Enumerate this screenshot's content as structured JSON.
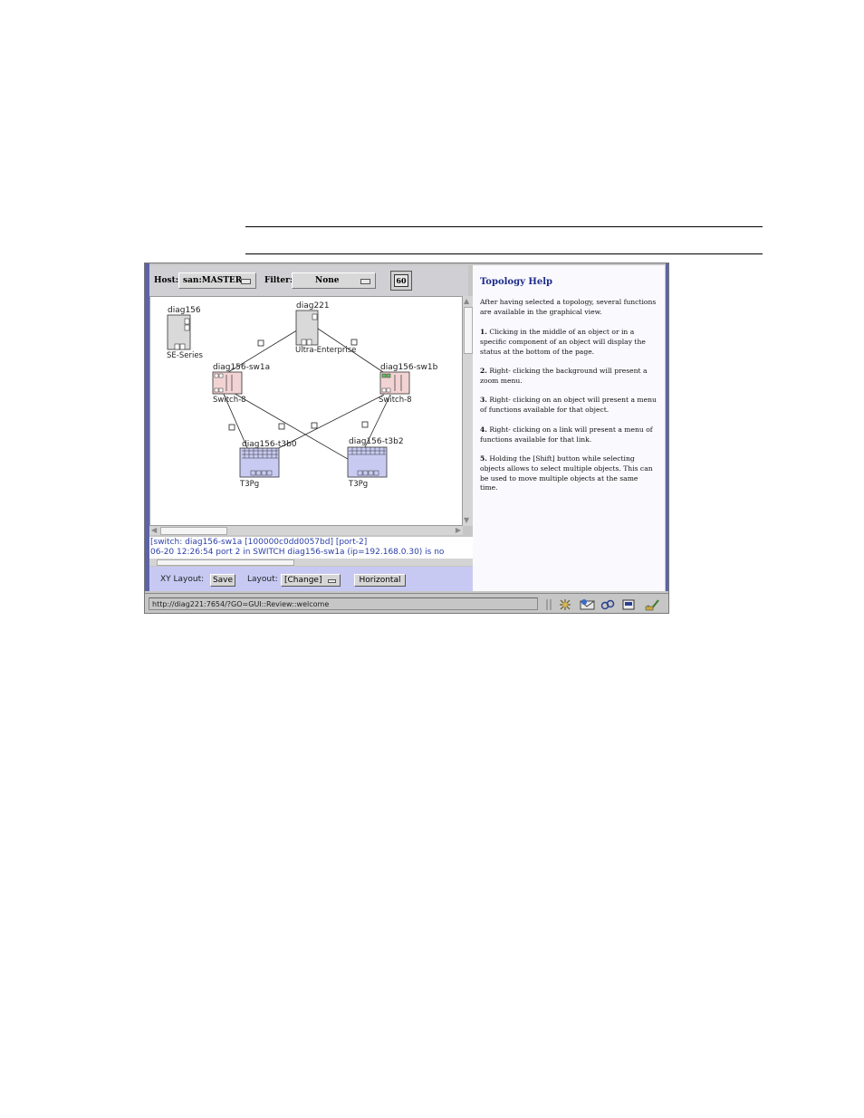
{
  "toolbar": {
    "host_label": "Host:",
    "host_value": "san:MASTER",
    "filter_label": "Filter:",
    "filter_value": "None",
    "go_label": "60"
  },
  "topology": {
    "nodes": {
      "diag156": {
        "name": "diag156",
        "type": "SE-Series"
      },
      "diag221": {
        "name": "diag221",
        "type": "Ultra-Enterprise"
      },
      "sw1a": {
        "name": "diag156-sw1a",
        "type": "Switch-8"
      },
      "sw1b": {
        "name": "diag156-sw1b",
        "type": "Switch-8"
      },
      "t3b0": {
        "name": "diag156-t3b0",
        "type": "T3Pg"
      },
      "t3b2": {
        "name": "diag156-t3b2",
        "type": "T3Pg"
      }
    }
  },
  "status": {
    "line1": "[switch: diag156-sw1a [100000c0dd0057bd]  [port-2]",
    "line2": " 06-20 12:26:54  port 2  in SWITCH diag156-sw1a (ip=192.168.0.30) is no"
  },
  "layout_bar": {
    "xy_label": "XY Layout:",
    "save_label": "Save",
    "layout_label": "Layout:",
    "change_label": "[Change]",
    "horizontal_label": "Horizontal"
  },
  "help": {
    "title": "Topology Help",
    "intro": "After having selected a topology, several functions are available in the graphical view.",
    "items": [
      {
        "num": "1.",
        "text": "Clicking in the middle of an object or in a specific component of an object will display the status at the bottom of the page."
      },
      {
        "num": "2.",
        "text": "Right- clicking the background will present a zoom menu."
      },
      {
        "num": "3.",
        "text": "Right- clicking on an object will present a menu of functions available for that object."
      },
      {
        "num": "4.",
        "text": "Right- clicking on a link will present a menu of functions available for that link."
      },
      {
        "num": "5.",
        "text": "Holding the [Shift] button while selecting objects allows to select multiple objects. This can be used to move multiple objects at the same time."
      }
    ]
  },
  "browser_status": {
    "url": "http://diag221:7654/?GO=GUI::Review::welcome"
  },
  "colors": {
    "frame_edge": "#5d63a8",
    "layout_bar": "#c7c9f3",
    "switch_fill": "#f2d3d3",
    "storage_fill": "#c8caf2",
    "host_fill": "#d9d9d9",
    "status_text": "#2b3fa8",
    "help_title": "#1c2a8a"
  },
  "icons": [
    "grip-icon",
    "network-icon",
    "mail-icon",
    "link-icon",
    "edit-icon",
    "security-icon"
  ]
}
